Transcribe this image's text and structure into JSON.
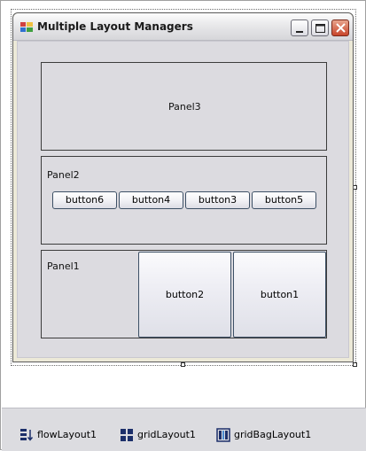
{
  "window": {
    "title": "Multiple Layout Managers",
    "buttons": [
      "minimize",
      "maximize",
      "close"
    ]
  },
  "panels": {
    "panel3": {
      "label": "Panel3"
    },
    "panel2": {
      "label": "Panel2",
      "buttons": [
        "button6",
        "button4",
        "button3",
        "button5"
      ]
    },
    "panel1": {
      "label": "Panel1",
      "buttons": [
        "button2",
        "button1"
      ]
    }
  },
  "tray": {
    "items": [
      {
        "label": "flowLayout1",
        "icon": "flow-layout-icon"
      },
      {
        "label": "gridLayout1",
        "icon": "grid-layout-icon"
      },
      {
        "label": "gridBagLayout1",
        "icon": "gridbag-layout-icon"
      }
    ]
  },
  "colors": {
    "client_bg": "#dcdbe0",
    "close_button": "#c8452a",
    "button_border": "#3d5066"
  }
}
